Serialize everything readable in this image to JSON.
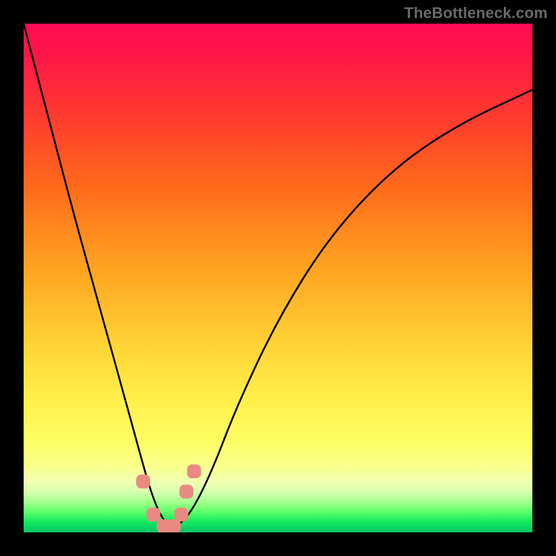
{
  "watermark": "TheBottleneck.com",
  "colors": {
    "frame": "#000000",
    "curve": "#000000",
    "marker": "#e98a82",
    "watermark": "#6a6a6a"
  },
  "chart_data": {
    "type": "line",
    "title": "",
    "xlabel": "",
    "ylabel": "",
    "xlim": [
      0,
      100
    ],
    "ylim": [
      0,
      100
    ],
    "grid": false,
    "legend": false,
    "series": [
      {
        "name": "bottleneck-curve",
        "x": [
          0,
          5,
          10,
          15,
          20,
          23,
          25,
          27,
          29,
          30,
          33,
          37,
          42,
          50,
          60,
          72,
          85,
          100
        ],
        "y": [
          100,
          81,
          62,
          44,
          26,
          15,
          8,
          3,
          1,
          1,
          4,
          12,
          25,
          42,
          58,
          71,
          80,
          87
        ]
      }
    ],
    "markers": {
      "name": "highlighted-points",
      "x": [
        23.5,
        25.5,
        27.5,
        29.5,
        31,
        32,
        33.5
      ],
      "y": [
        10,
        3.5,
        1.2,
        1.2,
        3.5,
        8,
        12
      ]
    }
  }
}
